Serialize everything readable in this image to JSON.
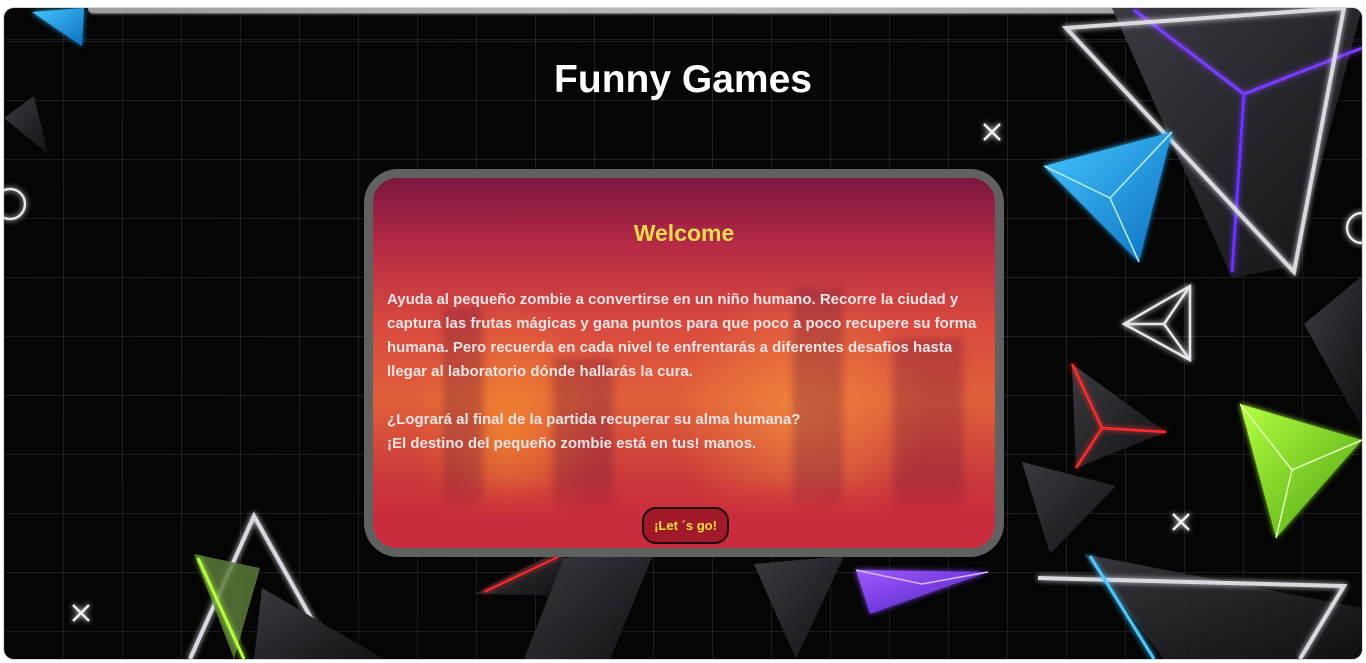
{
  "page": {
    "title": "Funny Games"
  },
  "card": {
    "heading": "Welcome",
    "paragraph_1": "Ayuda al pequeño zombie a convertirse en un niño humano. Recorre la ciudad y captura las frutas mágicas y gana puntos para que poco a poco recupere su forma humana. Pero recuerda en cada nivel te enfrentarás a diferentes desafios hasta llegar al laboratorio dónde hallarás la cura.",
    "question_line": "¿Logrará al final de la partida recuperar su alma humana?",
    "destiny_line": "¡El destino del pequeño zombie está en tus! manos.",
    "cta_label": "¡Let ´s go!"
  },
  "colors": {
    "background": "#070707",
    "title_text": "#ffffff",
    "card_frame": "#616161",
    "heading_text": "#ecd94f",
    "body_text": "#f1e4e4",
    "cta_background": "#a2192a",
    "cta_text": "#f2dd3e"
  },
  "decorations": [
    "blue-triangle-icon",
    "white-outline-triangle-icon",
    "purple-triangle-icon",
    "green-triangle-icon",
    "red-triangle-icon",
    "cross-icon",
    "ring-icon"
  ]
}
